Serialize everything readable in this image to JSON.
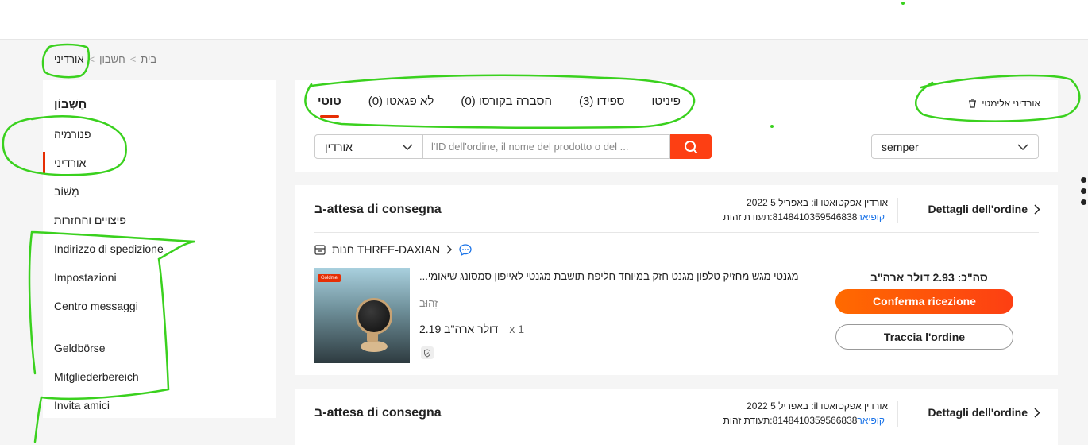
{
  "breadcrumb": {
    "home": "בית",
    "account": "חשבון",
    "current": "אורדיני"
  },
  "sidebar": {
    "title": "חֶשְׁבּוֹן",
    "group1": [
      "פנורמיה",
      "אורדיני",
      "מָשׁוֹב",
      "פיצויים והחזרות",
      "Indirizzo di spedizione",
      "Impostazioni",
      "Centro messaggi"
    ],
    "group2": [
      "Geldbörse",
      "Mitgliederbereich",
      "Invita amici"
    ],
    "active_index": 1
  },
  "tabs": [
    "טוטי",
    "לא פגאטו (0)",
    "הסברה בקורסו (0)",
    "ספידו (3)",
    "פיניטו"
  ],
  "delete_label": "אורדיני אלימטי",
  "search": {
    "type_value": "אורדין",
    "placeholder": "l'ID dell'ordine, il nome del prodotto o del ..."
  },
  "time_filter": "semper",
  "orders": [
    {
      "status": "ב-attesa di consegna",
      "date_line": "באפריל 5 2022 :il אורדין אפקטואטו",
      "id_line": "8148410359546838:תעודת זהות",
      "copy": "קופיאר",
      "details": "Dettagli dell'ordine",
      "store": "חנות THREE-DAXIAN",
      "product": {
        "badge": "Goldme",
        "title": "מגנטי מגש מחזיק טלפון מגנט חזק במיוחד חליפת תושבת מגנטי לאייפון סמסונג שיאומי...",
        "variant": "זָהוּב",
        "price": "2.19 דולר ארה\"ב",
        "qty": "x 1"
      },
      "total": "סה\"כ: 2.93 דולר ארה\"ב",
      "confirm": "Conferma ricezione",
      "track": "Traccia l'ordine"
    },
    {
      "status": "ב-attesa di consegna",
      "date_line": "באפריל 5 2022 :il אורדין אפקטואטו",
      "id_line": "8148410359566838:תעודת זהות",
      "copy": "קופיאר",
      "details": "Dettagli dell'ordine"
    }
  ],
  "colors": {
    "accent": "#fd3f13",
    "active_bar": "#e62e04",
    "link": "#1a73e8",
    "annotation": "#3ad11e"
  }
}
